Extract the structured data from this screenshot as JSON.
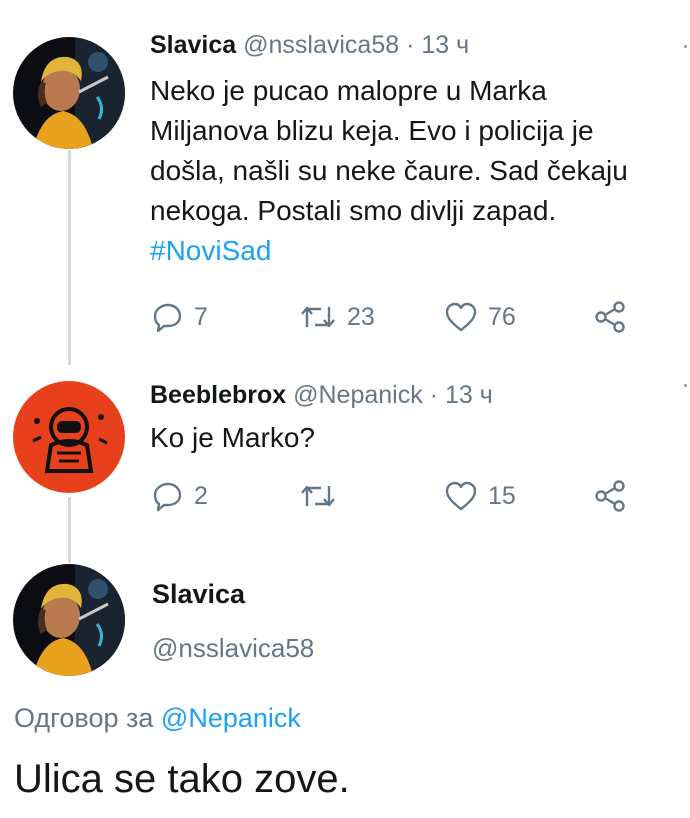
{
  "tweets": [
    {
      "name": "Slavica",
      "handle": "@nsslavica58",
      "time": "13 ч",
      "lines": [
        "Neko je pucao malopre u Marka",
        "Miljanova blizu keja. Evo i policija je",
        "došla, našli su neke čaure.  Sad čekaju",
        "nekoga. Postali smo divlji zapad."
      ],
      "hashtag": "#NoviSad",
      "replies": "7",
      "retweets": "23",
      "likes": "76"
    },
    {
      "name": "Beeblebrox",
      "handle": "@Nepanick",
      "time": "13 ч",
      "text": "Ko je Marko?",
      "replies": "2",
      "retweets": "",
      "likes": "15"
    }
  ],
  "main_tweet": {
    "name": "Slavica",
    "handle": "@nsslavica58",
    "reply_prefix": "Одговор за",
    "reply_mention": "@Nepanick",
    "text": "Ulica se tako zove."
  },
  "colors": {
    "accent": "#1da1f2",
    "secondary_text": "#657786",
    "avatar2_bg": "#e8401c"
  },
  "icons": [
    "reply-icon",
    "retweet-icon",
    "like-icon",
    "share-icon"
  ]
}
